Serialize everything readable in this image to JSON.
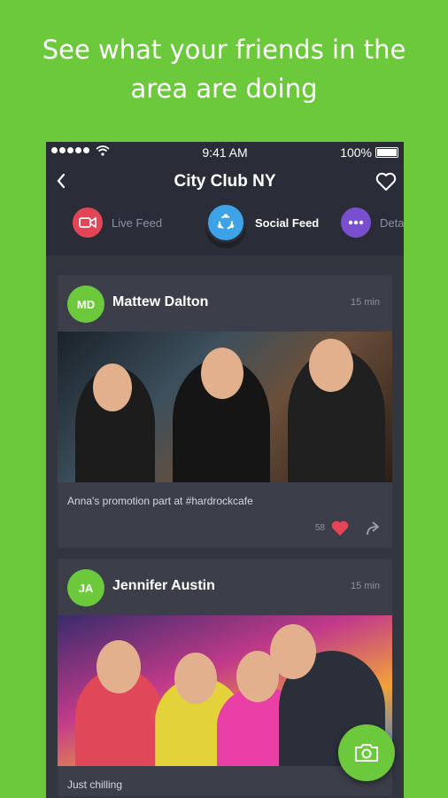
{
  "promo": {
    "line1": "See what your friends in the",
    "line2": "area are doing"
  },
  "status_bar": {
    "time": "9:41 AM",
    "battery": "100%"
  },
  "header": {
    "title": "City Club NY"
  },
  "tabs": [
    {
      "label": "Live Feed",
      "icon": "video-camera-icon",
      "color": "#e34556"
    },
    {
      "label": "Social Feed",
      "icon": "social-share-icon",
      "color": "#3ea3e6",
      "active": true
    },
    {
      "label": "Deta",
      "icon": "more-dots-icon",
      "color": "#7a4fcf"
    }
  ],
  "posts": [
    {
      "initials": "MD",
      "name": "Mattew Dalton",
      "time": "15 min",
      "caption": "Anna's promotion part at #hardrockcafe",
      "likes": "58"
    },
    {
      "initials": "JA",
      "name": "Jennifer Austin",
      "time": "15 min",
      "caption": "Just chilling"
    }
  ],
  "colors": {
    "accent": "#6cc93c",
    "like": "#e34556"
  }
}
